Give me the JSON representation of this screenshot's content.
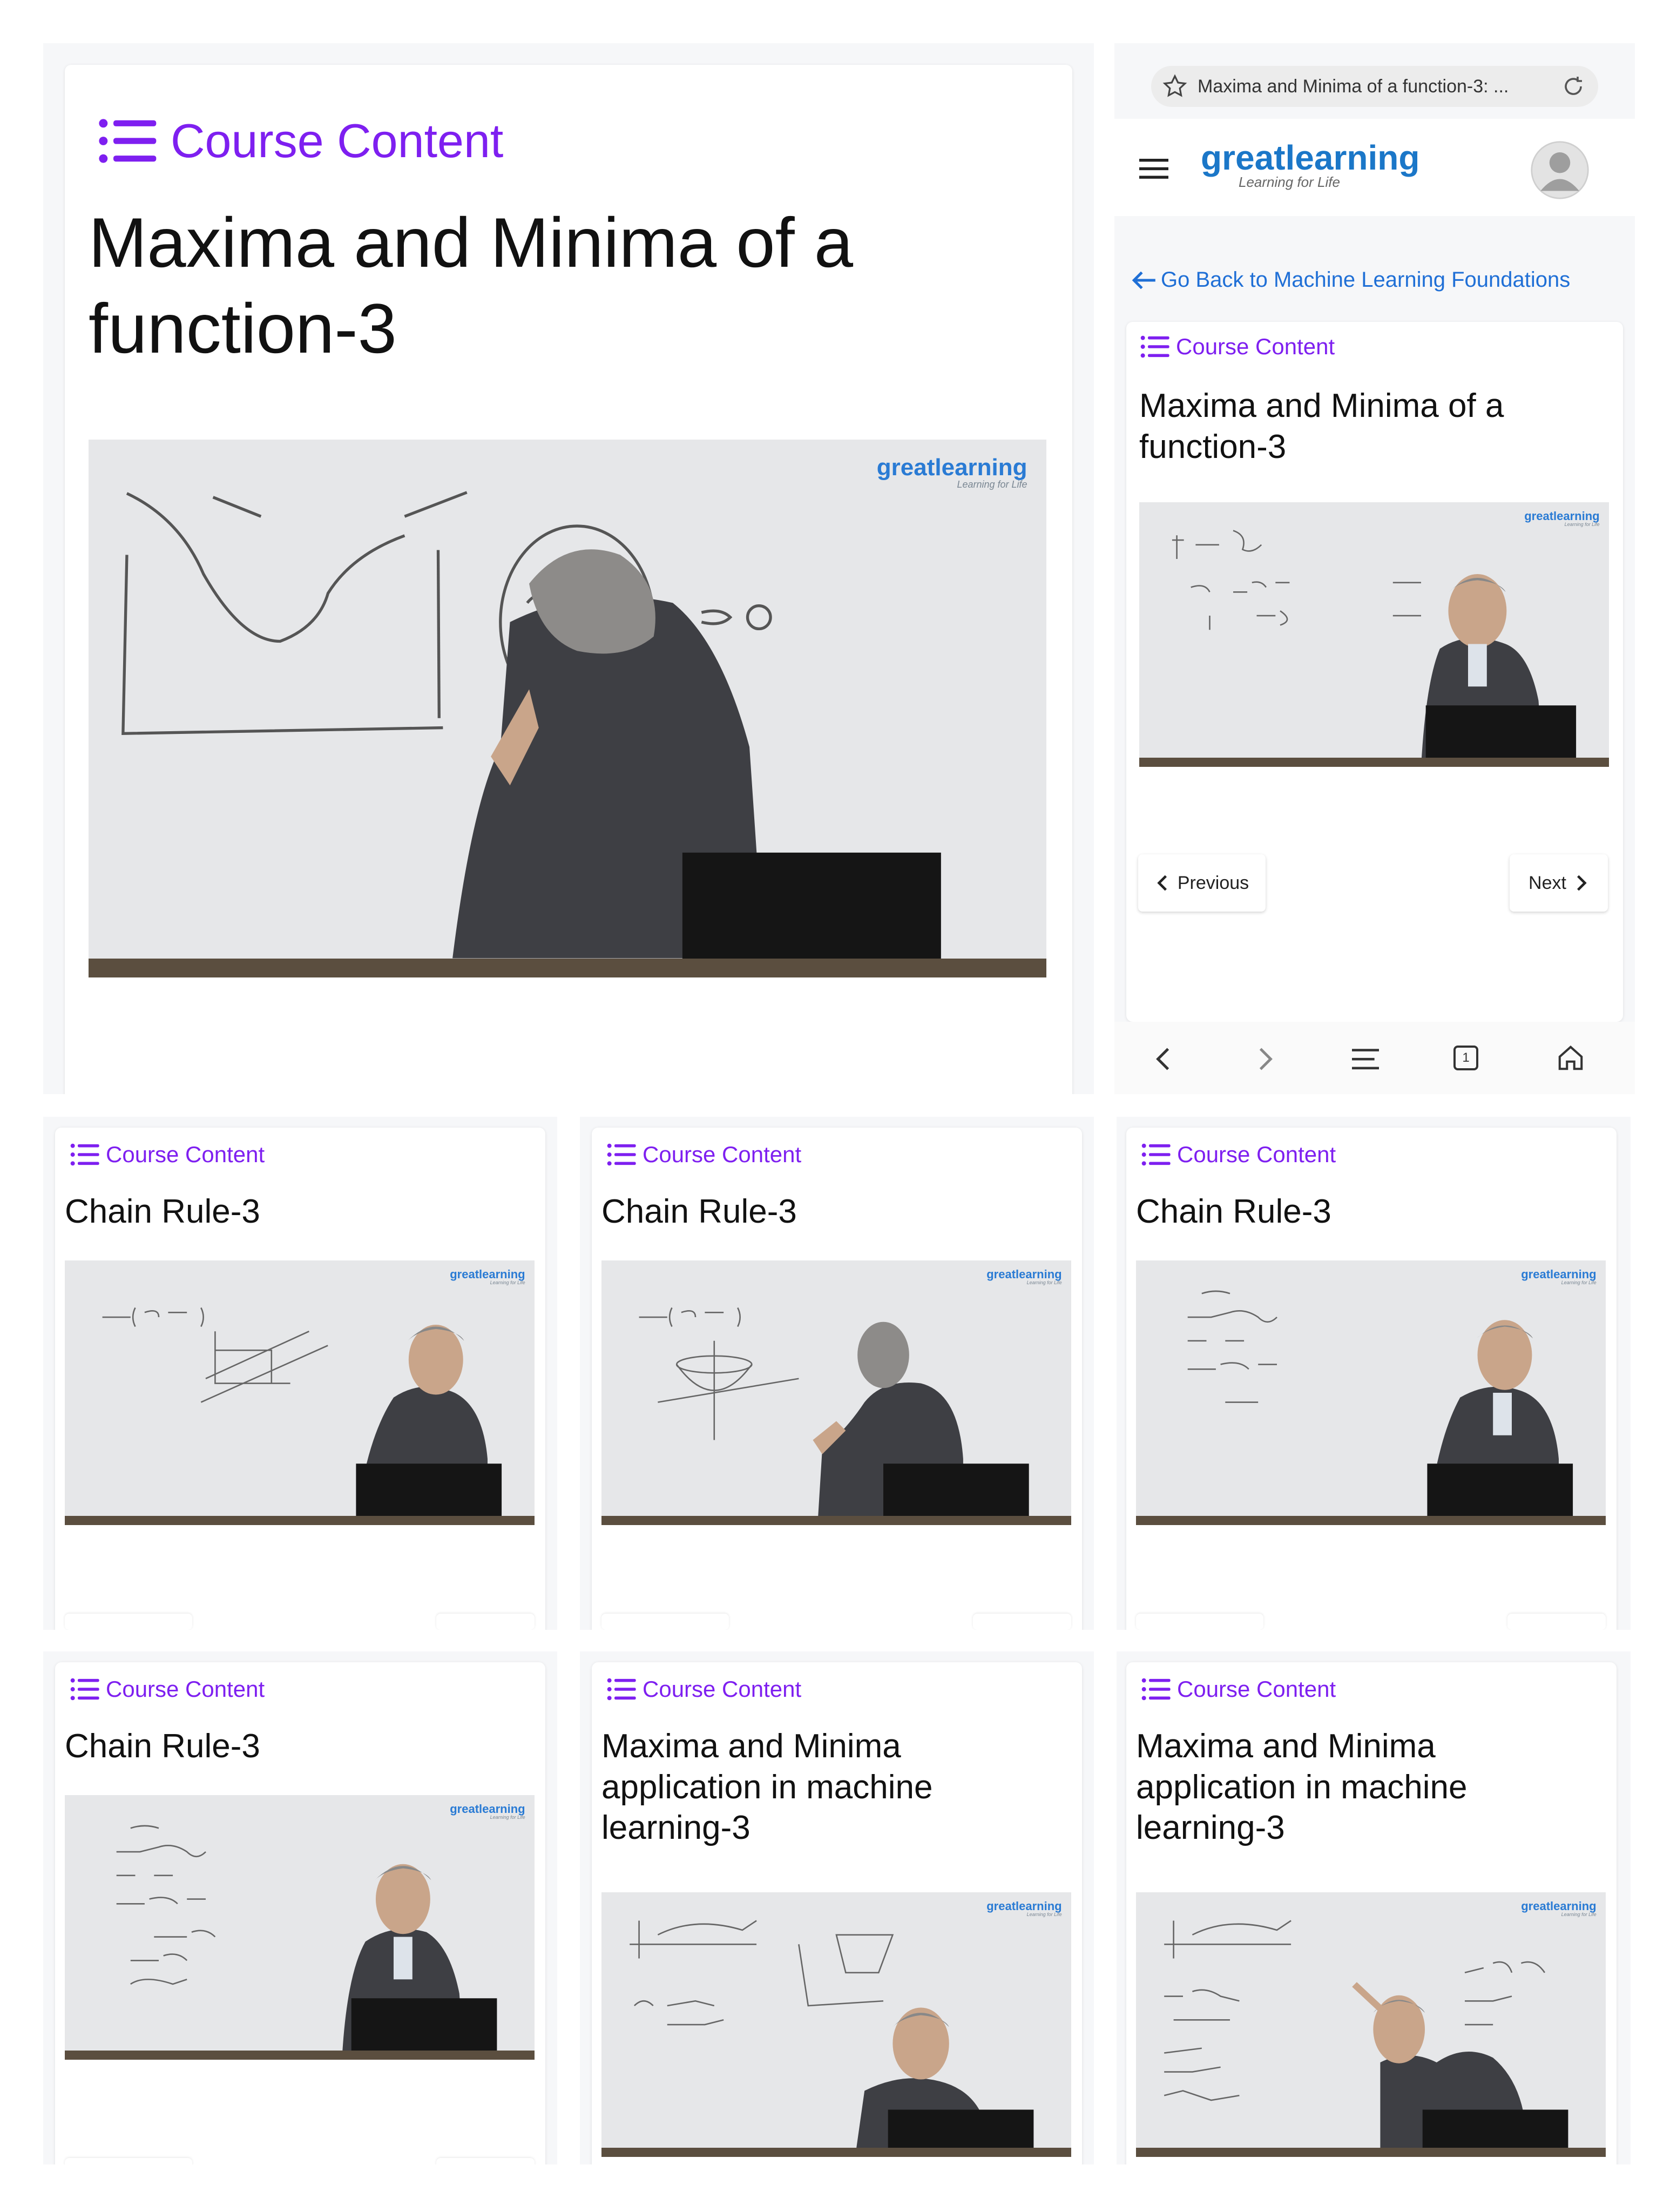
{
  "colors": {
    "accent": "#7e1ff0",
    "link": "#1f6fd6",
    "brand_blue": "#1b77c8"
  },
  "course_content_label": "Course Content",
  "browser": {
    "url_title": "Maxima and Minima of a function-3: ...",
    "brand_name": "greatlearning",
    "brand_tagline": "Learning for Life",
    "back_link": "Go Back to Machine Learning Foundations",
    "prev_label": "Previous",
    "next_label": "Next",
    "tab_count": "1"
  },
  "video_logo": {
    "name": "greatlearning",
    "tagline": "Learning for Life"
  },
  "main_panel": {
    "title": "Maxima and Minima of a function-3"
  },
  "phone_panel": {
    "title": "Maxima and Minima of a function-3"
  },
  "grid": [
    {
      "title": "Chain Rule-3"
    },
    {
      "title": "Chain Rule-3"
    },
    {
      "title": "Chain Rule-3"
    },
    {
      "title": "Chain Rule-3"
    },
    {
      "title": "Maxima and Minima application in machine learning-3"
    },
    {
      "title": "Maxima and Minima application in machine learning-3"
    }
  ],
  "icons": [
    "list-icon",
    "star-icon",
    "reload-icon",
    "menu-icon",
    "avatar-icon",
    "arrow-left-icon",
    "chevron-left-icon",
    "chevron-right-icon",
    "back-icon",
    "forward-icon",
    "tabs-icon",
    "home-icon"
  ]
}
